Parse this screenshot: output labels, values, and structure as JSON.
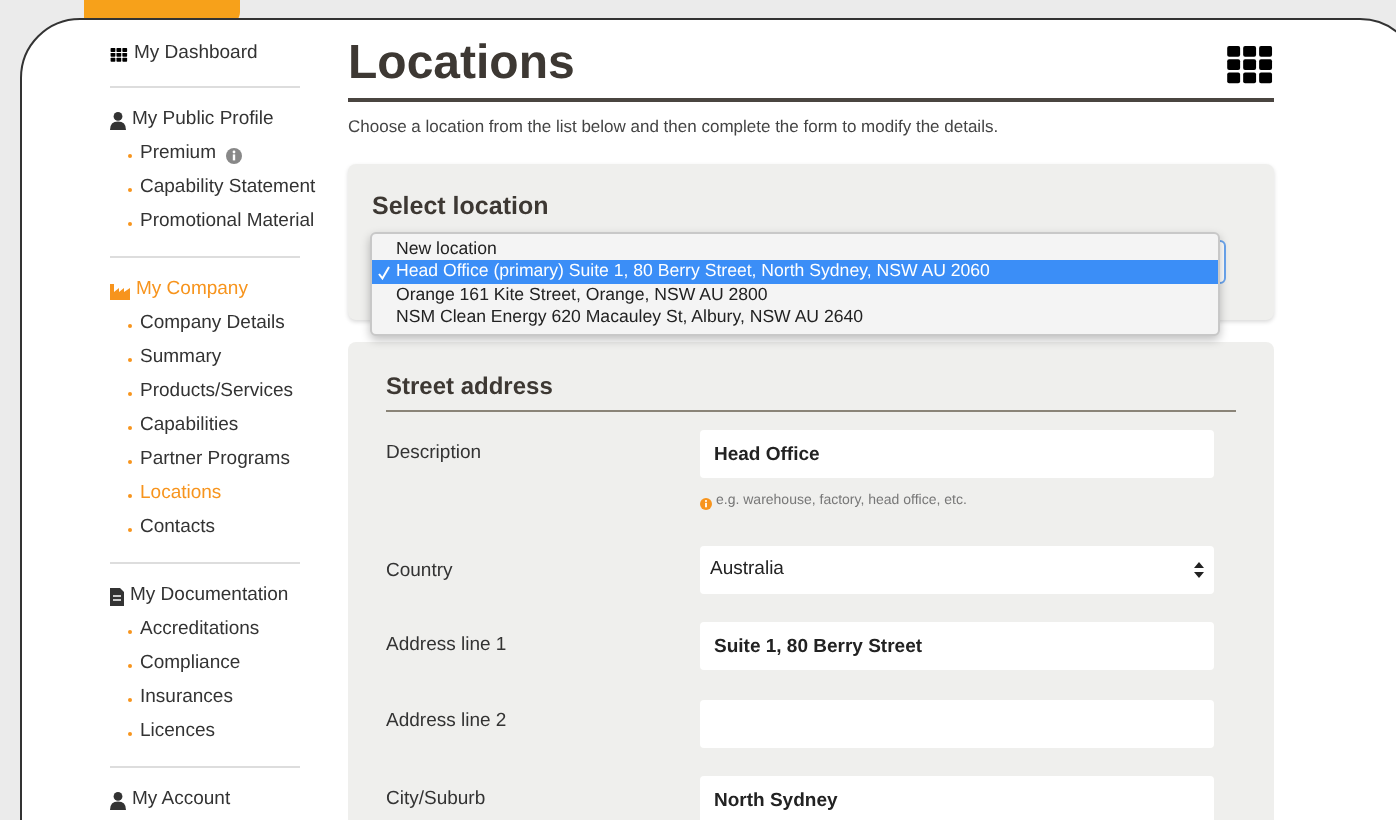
{
  "sidebar": {
    "dashboard": "My Dashboard",
    "sections": [
      {
        "title": "My Public Profile",
        "selected": false,
        "items": [
          {
            "label": "Premium",
            "selected": false,
            "info": true
          },
          {
            "label": "Capability Statement",
            "selected": false,
            "info": false
          },
          {
            "label": "Promotional Material",
            "selected": false,
            "info": false
          }
        ]
      },
      {
        "title": "My Company",
        "selected": true,
        "items": [
          {
            "label": "Company Details",
            "selected": false,
            "info": false
          },
          {
            "label": "Summary",
            "selected": false,
            "info": false
          },
          {
            "label": "Products/Services",
            "selected": false,
            "info": false
          },
          {
            "label": "Capabilities",
            "selected": false,
            "info": false
          },
          {
            "label": "Partner Programs",
            "selected": false,
            "info": false
          },
          {
            "label": "Locations",
            "selected": true,
            "info": false
          },
          {
            "label": "Contacts",
            "selected": false,
            "info": false
          }
        ]
      },
      {
        "title": "My Documentation",
        "selected": false,
        "items": [
          {
            "label": "Accreditations",
            "selected": false,
            "info": false
          },
          {
            "label": "Compliance",
            "selected": false,
            "info": false
          },
          {
            "label": "Insurances",
            "selected": false,
            "info": false
          },
          {
            "label": "Licences",
            "selected": false,
            "info": false
          }
        ]
      },
      {
        "title": "My Account",
        "selected": false
      }
    ]
  },
  "page": {
    "title": "Locations",
    "intro": "Choose a location from the list below and then complete the form to modify the details."
  },
  "select_location": {
    "title": "Select location",
    "options": [
      {
        "label": "New location",
        "selected": false
      },
      {
        "label": "Head Office (primary) Suite 1, 80 Berry Street, North Sydney, NSW AU 2060",
        "selected": true
      },
      {
        "label": "Orange 161 Kite Street, Orange, NSW AU 2800",
        "selected": false
      },
      {
        "label": "NSM Clean Energy 620 Macauley St, Albury, NSW AU 2640",
        "selected": false
      }
    ]
  },
  "street_address": {
    "title": "Street address",
    "fields": [
      {
        "kind": "text",
        "label": "Description",
        "value": "Head Office",
        "hint": "e.g. warehouse, factory, head office, etc."
      },
      {
        "kind": "select",
        "label": "Country",
        "value": "Australia"
      },
      {
        "kind": "text",
        "label": "Address line 1",
        "value": "Suite 1, 80 Berry Street"
      },
      {
        "kind": "text",
        "label": "Address line 2"
      },
      {
        "kind": "text",
        "label": "City/Suburb",
        "value": "North Sydney"
      }
    ]
  }
}
